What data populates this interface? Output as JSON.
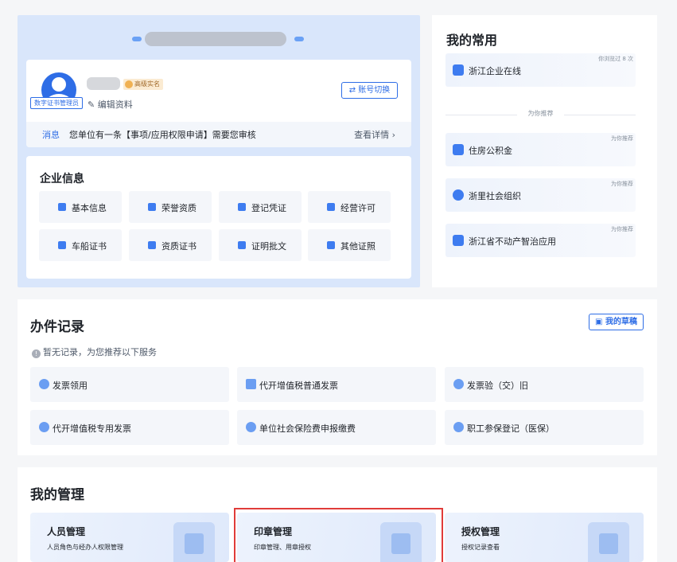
{
  "profile": {
    "role_badge": "数字证书管理员",
    "level_badge": "高级实名",
    "edit_link": "编辑资料",
    "switch_account": "账号切换"
  },
  "message": {
    "tag": "消息",
    "text": "您单位有一条【事项/应用权限申请】需要您审核",
    "more": "查看详情"
  },
  "enterprise": {
    "title": "企业信息",
    "items": [
      {
        "label": "基本信息",
        "icon": "doc-icon"
      },
      {
        "label": "荣誉资质",
        "icon": "badge-icon"
      },
      {
        "label": "登记凭证",
        "icon": "register-icon"
      },
      {
        "label": "经营许可",
        "icon": "shield-icon"
      },
      {
        "label": "车船证书",
        "icon": "card-icon"
      },
      {
        "label": "资质证书",
        "icon": "certificate-icon"
      },
      {
        "label": "证明批文",
        "icon": "proof-icon"
      },
      {
        "label": "其他证照",
        "icon": "license-icon"
      }
    ]
  },
  "favorites": {
    "title": "我的常用",
    "divider": "为你推荐",
    "items": [
      {
        "label": "浙江企业在线",
        "tag": "你浏览过 8 次"
      },
      {
        "label": "住房公积金",
        "tag": "为你推荐"
      },
      {
        "label": "浙里社会组织",
        "tag": "为你推荐"
      },
      {
        "label": "浙江省不动产智治应用",
        "tag": "为你推荐"
      }
    ]
  },
  "records": {
    "title": "办件记录",
    "draft_button": "我的草稿",
    "empty_tip": "暂无记录，为您推荐以下服务",
    "services": [
      {
        "label": "发票领用"
      },
      {
        "label": "代开增值税普通发票"
      },
      {
        "label": "发票验（交）旧"
      },
      {
        "label": "代开增值税专用发票"
      },
      {
        "label": "单位社会保险费申报缴费"
      },
      {
        "label": "职工参保登记（医保）"
      }
    ]
  },
  "manage": {
    "title": "我的管理",
    "cards": [
      {
        "title": "人员管理",
        "desc": "人员角色与经办人权限管理",
        "icon": "org-chart-icon"
      },
      {
        "title": "印章管理",
        "desc": "印章管理、用章授权",
        "icon": "stamp-icon"
      },
      {
        "title": "授权管理",
        "desc": "授权记录查看",
        "icon": "key-icon"
      }
    ]
  },
  "colors": {
    "accent": "#2e6de6",
    "highlight": "#e03c3a"
  }
}
